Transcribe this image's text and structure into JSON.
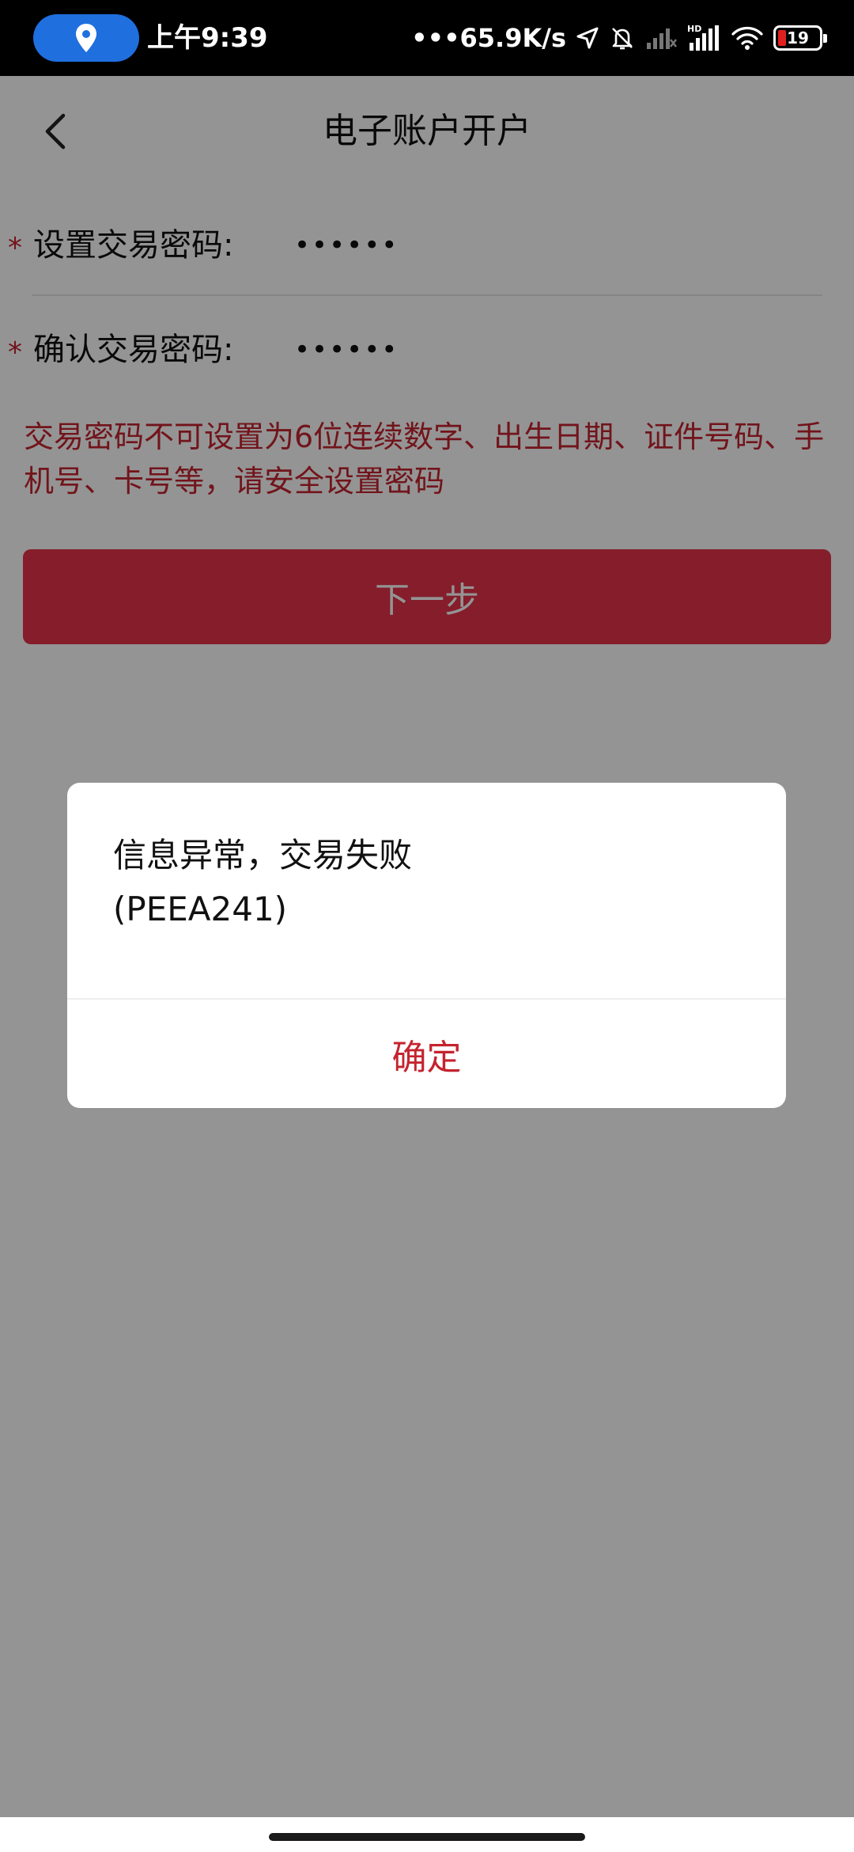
{
  "status_bar": {
    "time": "上午9:39",
    "net_speed": "65.9K/s",
    "battery_level": "19",
    "icons": [
      "location-icon",
      "navigation-arrow-icon",
      "mute-bell-icon",
      "no-signal-icon",
      "hd-signal-icon",
      "wifi-icon",
      "battery-icon"
    ]
  },
  "nav": {
    "title": "电子账户开户",
    "back_icon": "chevron-left-icon"
  },
  "form": {
    "required_mark": "*",
    "set_password": {
      "label": "设置交易密码:",
      "value": "••••••"
    },
    "confirm_password": {
      "label": "确认交易密码:",
      "value": "••••••"
    }
  },
  "tip": {
    "text": "交易密码不可设置为6位连续数字、出生日期、证件号码、手机号、卡号等，请安全设置密码"
  },
  "next_button": {
    "label": "下一步"
  },
  "dialog": {
    "message_line1": "信息异常，交易失败",
    "message_line2": "(PEEA241)",
    "confirm_label": "确定"
  },
  "colors": {
    "accent_red": "#c4242f",
    "button_red": "#e5324a",
    "overlay": "rgba(0,0,0,0.42)",
    "status_bar_bg": "#000000",
    "location_pill": "#1f6fde"
  }
}
